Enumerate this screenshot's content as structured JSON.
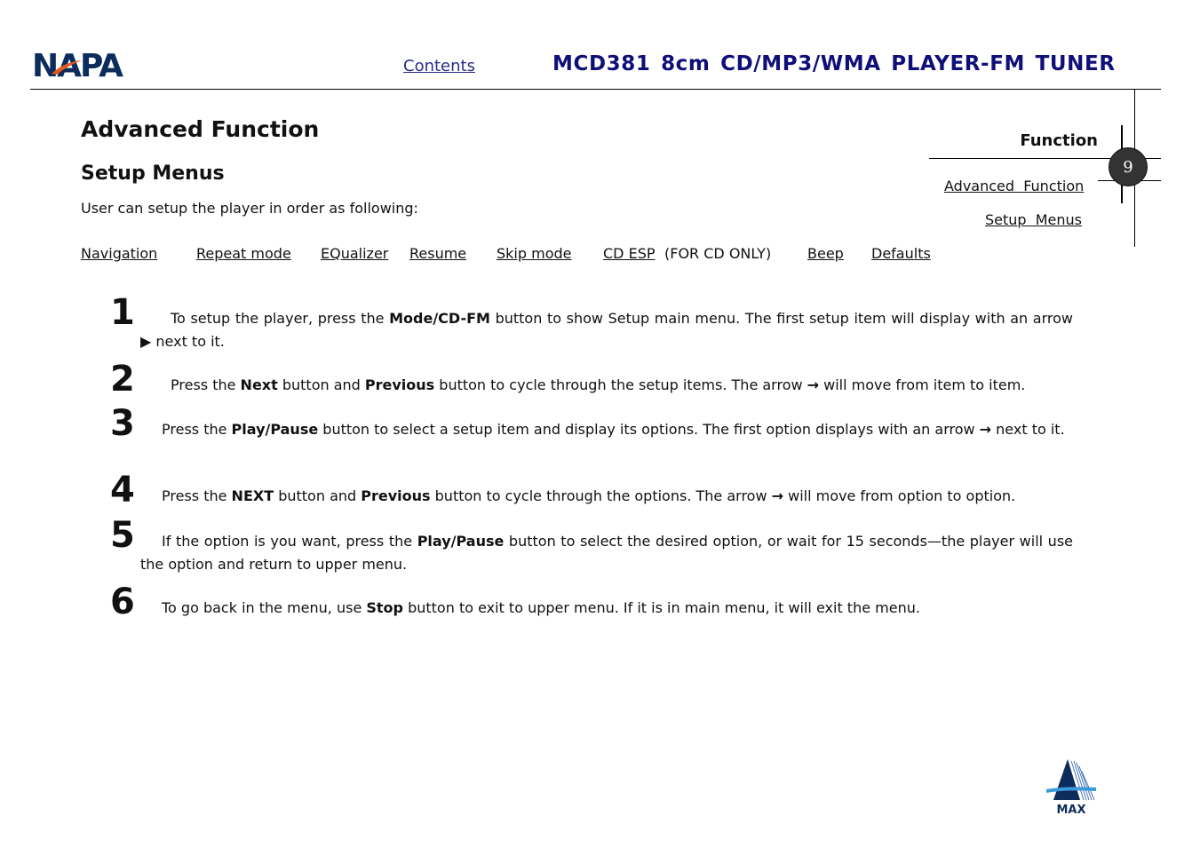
{
  "header": {
    "logo_text": "NAPA",
    "contents_link": "Contents",
    "title": "MCD381  8cm  CD/MP3/WMA  PLAYER-FM  TUNER",
    "brand_colors": {
      "navy": "#0f0f7a",
      "logo_blue": "#0c2c5c",
      "logo_orange": "#e8571c"
    }
  },
  "main": {
    "heading": "Advanced Function",
    "subheading": "Setup Menus",
    "intro": "User can setup the player in order as following:",
    "menu_items": [
      {
        "label": "Navigation"
      },
      {
        "label": "Repeat mode"
      },
      {
        "label": "EQualizer"
      },
      {
        "label": "Resume"
      },
      {
        "label": "Skip mode"
      },
      {
        "label": "CD ESP",
        "note": "(FOR CD ONLY)"
      },
      {
        "label": "Beep"
      },
      {
        "label": "Defaults"
      }
    ]
  },
  "side_nav": {
    "section": "Function",
    "page_number": "9",
    "links": [
      "Advanced  Function",
      "Setup  Menus"
    ]
  },
  "steps": [
    {
      "num": "1",
      "parts": [
        {
          "t": "To setup the player, press the "
        },
        {
          "b": "Mode/CD-FM"
        },
        {
          "t": " button to show Setup main menu. The first setup item will display with an arrow "
        },
        {
          "a": "▶"
        },
        {
          "t": " next to it."
        }
      ]
    },
    {
      "num": "2",
      "parts": [
        {
          "t": "Press the "
        },
        {
          "b": "Next"
        },
        {
          "t": " button and "
        },
        {
          "b": "Previous"
        },
        {
          "t": " button to cycle through the setup items. The arrow "
        },
        {
          "a": "→"
        },
        {
          "t": " will move from item to item."
        }
      ]
    },
    {
      "num": "3",
      "parts": [
        {
          "t": "Press the "
        },
        {
          "b": "Play/Pause"
        },
        {
          "t": " button to select a setup item and display its options. The first option displays with an arrow "
        },
        {
          "a": "→"
        },
        {
          "t": " next to it."
        }
      ]
    },
    {
      "num": "4",
      "parts": [
        {
          "t": "Press the "
        },
        {
          "b": "NEXT"
        },
        {
          "t": " button and "
        },
        {
          "b": "Previous"
        },
        {
          "t": " button to cycle through the options. The arrow "
        },
        {
          "a": "→"
        },
        {
          "t": " will move from option to option."
        }
      ]
    },
    {
      "num": "5",
      "parts": [
        {
          "t": "If the option is you want, press the "
        },
        {
          "b": "Play/Pause"
        },
        {
          "t": " button to select the desired option, or wait for 15 seconds—the player will use the option and return to upper menu."
        }
      ]
    },
    {
      "num": "6",
      "parts": [
        {
          "t": "To go back in the menu, use "
        },
        {
          "b": "Stop"
        },
        {
          "t": " button to exit to upper menu. If it is in main menu, it will exit the menu."
        }
      ]
    }
  ],
  "footer": {
    "logo_text": "MAX"
  }
}
